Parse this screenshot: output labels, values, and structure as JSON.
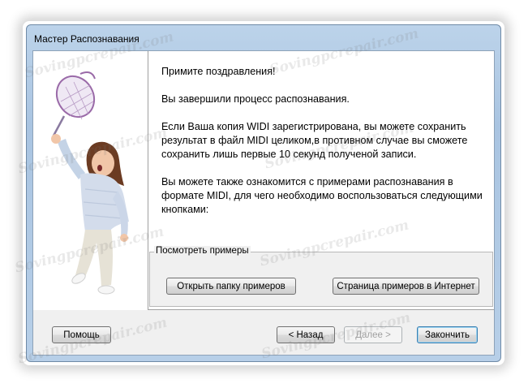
{
  "window": {
    "title": "Мастер Распознавания"
  },
  "content": {
    "paragraphs": [
      "Примите поздравления!",
      "Вы завершили процесс распознавания.",
      "Если Ваша копия WIDI зарегистрирована, вы можете сохранить результат в файл MIDI целиком,в противном случае вы сможете сохранить лишь первые 10 секунд полученой записи.",
      "Вы можете также ознакомится с примерами распознавания в формате MIDI, для чего необходимо воспользоваться следующими кнопками:"
    ]
  },
  "examples_group": {
    "label": "Посмотреть примеры",
    "open_folder_label": "Открыть папку примеров",
    "online_page_label": "Страница примеров в Интернет"
  },
  "footer": {
    "help_label": "Помощь",
    "back_label": "< Назад",
    "next_label": "Далее >",
    "finish_label": "Закончить"
  },
  "watermark": {
    "text": "Sovingpcrepair.com"
  }
}
